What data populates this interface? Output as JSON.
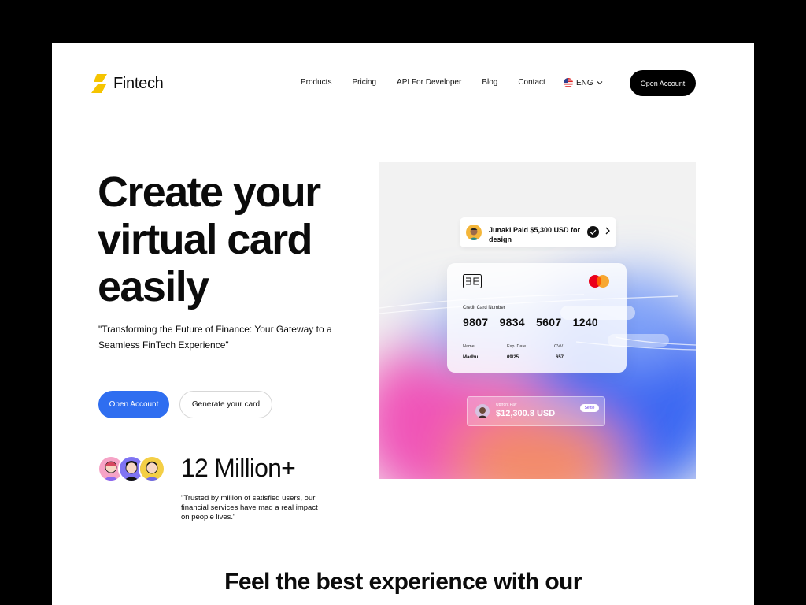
{
  "brand": {
    "name": "Fintech",
    "accent": "#f5c400"
  },
  "nav": {
    "items": [
      "Products",
      "Pricing",
      "API For Developer",
      "Blog",
      "Contact"
    ]
  },
  "language": {
    "label": "ENG"
  },
  "header": {
    "cta_label": "Open Account"
  },
  "hero": {
    "title_line1": "Create your",
    "title_line2": "virtual card",
    "title_line3": "easily",
    "subtitle": "\"Transforming the Future of Finance: Your Gateway to a Seamless FinTech Experience\"",
    "primary_button": "Open Account",
    "secondary_button": "Generate your card",
    "primary_color": "#2f6ef0"
  },
  "stats": {
    "value": "12 Million+",
    "description": "\"Trusted by million of satisfied users, our financial services have mad a real impact on people lives.\""
  },
  "notification": {
    "text": "Junaki Paid $5,300 USD for design"
  },
  "card": {
    "label": "Credit Card Number",
    "number": "9807 9834 5607 1240",
    "name_label": "Name",
    "name_value": "Madhu",
    "exp_label": "Exp. Date",
    "exp_value": "09/25",
    "cvv_label": "CVV",
    "cvv_value": "657"
  },
  "payment": {
    "label": "Upfront Pay",
    "amount": "$12,300.8 USD",
    "button": "Settle"
  },
  "section": {
    "heading_light1": "Feel the ",
    "heading_bold1": "best experience",
    "heading_light2": " with ",
    "heading_bold2": "our"
  }
}
